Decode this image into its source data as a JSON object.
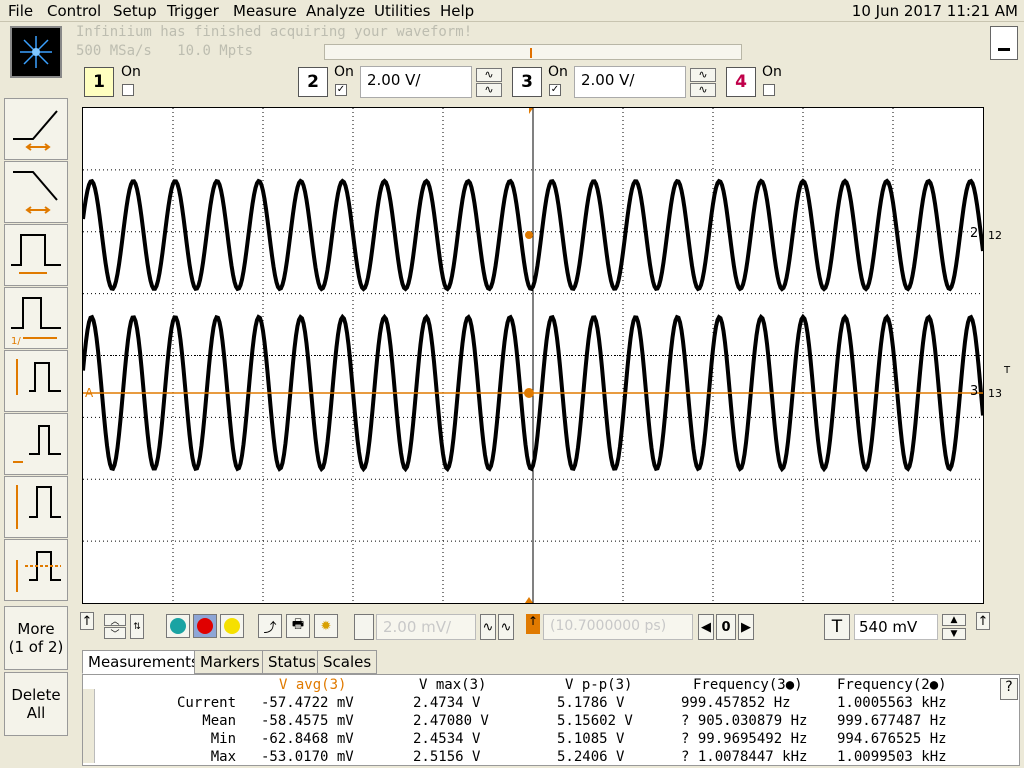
{
  "menu": [
    "File",
    "Control",
    "Setup",
    "Trigger",
    "Measure",
    "Analyze",
    "Utilities",
    "Help"
  ],
  "datetime": "10 Jun 2017 11:21 AM",
  "status": {
    "message": "Infiniium has finished acquiring your waveform!",
    "rate": "500 MSa/s",
    "points": "10.0 Mpts"
  },
  "channels": [
    {
      "num": "1",
      "on_label": "On",
      "enabled": false,
      "color": "#e6d600"
    },
    {
      "num": "2",
      "on_label": "On",
      "enabled": true,
      "scale": "2.00 V/",
      "color": "#000000"
    },
    {
      "num": "3",
      "on_label": "On",
      "enabled": true,
      "scale": "2.00 V/",
      "color": "#000000"
    },
    {
      "num": "4",
      "on_label": "On",
      "enabled": false,
      "color": "#c0004a"
    }
  ],
  "trace_labels": {
    "ch2": "2",
    "ch3": "3",
    "ch2_gnd": "12",
    "ch3_gnd": "13",
    "trig": "T",
    "a_marker": "A"
  },
  "bottom": {
    "delay_value": "2.00 mV/",
    "timebase_value": "(10.7000000 ps)",
    "zero_label": "0",
    "trigger_label": "T",
    "trigger_level": "540 mV"
  },
  "left_buttons": {
    "more": "More",
    "more_sub": "(1 of 2)",
    "delete": "Delete",
    "delete_sub": "All"
  },
  "tabs": [
    "Measurements",
    "Markers",
    "Status",
    "Scales"
  ],
  "meas": {
    "headers": [
      "V avg(3)",
      "V max(3)",
      "V p-p(3)",
      "Frequency(3●)",
      "Frequency(2●)"
    ],
    "rows": [
      {
        "label": "Current",
        "vals": [
          "-57.4722 mV",
          "2.4734 V",
          "5.1786 V",
          "999.457852 Hz",
          "1.0005563 kHz"
        ]
      },
      {
        "label": "Mean",
        "vals": [
          "-58.4575 mV",
          "2.47080 V",
          "5.15602 V",
          "? 905.030879 Hz",
          "999.677487 Hz"
        ]
      },
      {
        "label": "Min",
        "vals": [
          "-62.8468 mV",
          "2.4534 V",
          "5.1085 V",
          "? 99.9695492 Hz",
          "994.676525 Hz"
        ]
      },
      {
        "label": "Max",
        "vals": [
          "-53.0170 mV",
          "2.5156 V",
          "5.2406 V",
          "? 1.0078447 kHz",
          "1.0099503 kHz"
        ]
      }
    ]
  },
  "help_label": "?",
  "colors": {
    "grid": "#000000",
    "trace": "#000000",
    "cursor": "#e07a00"
  }
}
